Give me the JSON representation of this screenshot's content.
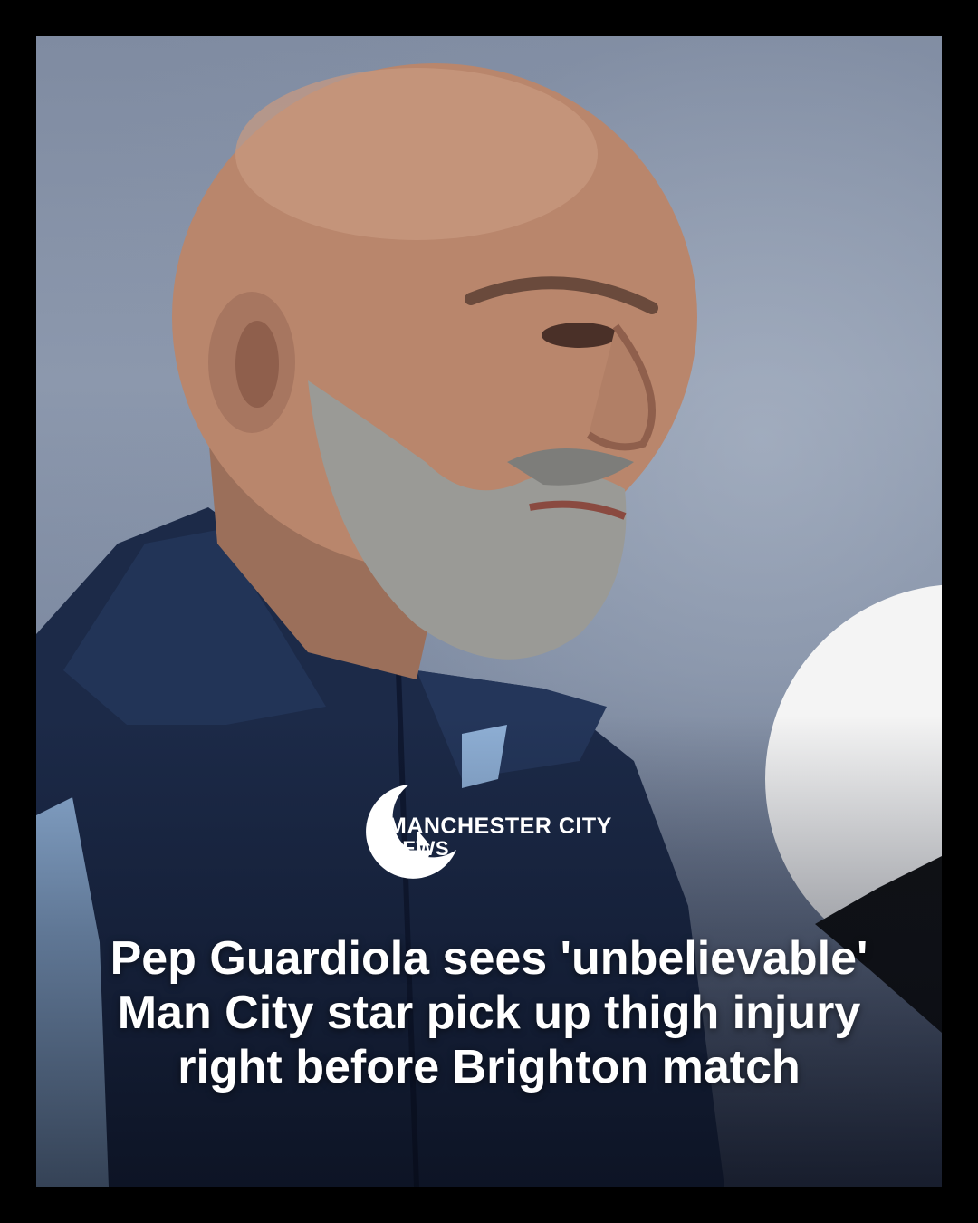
{
  "brand": {
    "line1": "MANCHESTER CITY",
    "line2": "NEWS"
  },
  "headline": "Pep Guardiola sees 'unbelievable' Man City star pick up thigh injury right before Brighton match",
  "colors": {
    "frame_border": "#000000",
    "text": "#ffffff",
    "jacket": "#1c2a48",
    "background_sky": "#8c98ad"
  }
}
